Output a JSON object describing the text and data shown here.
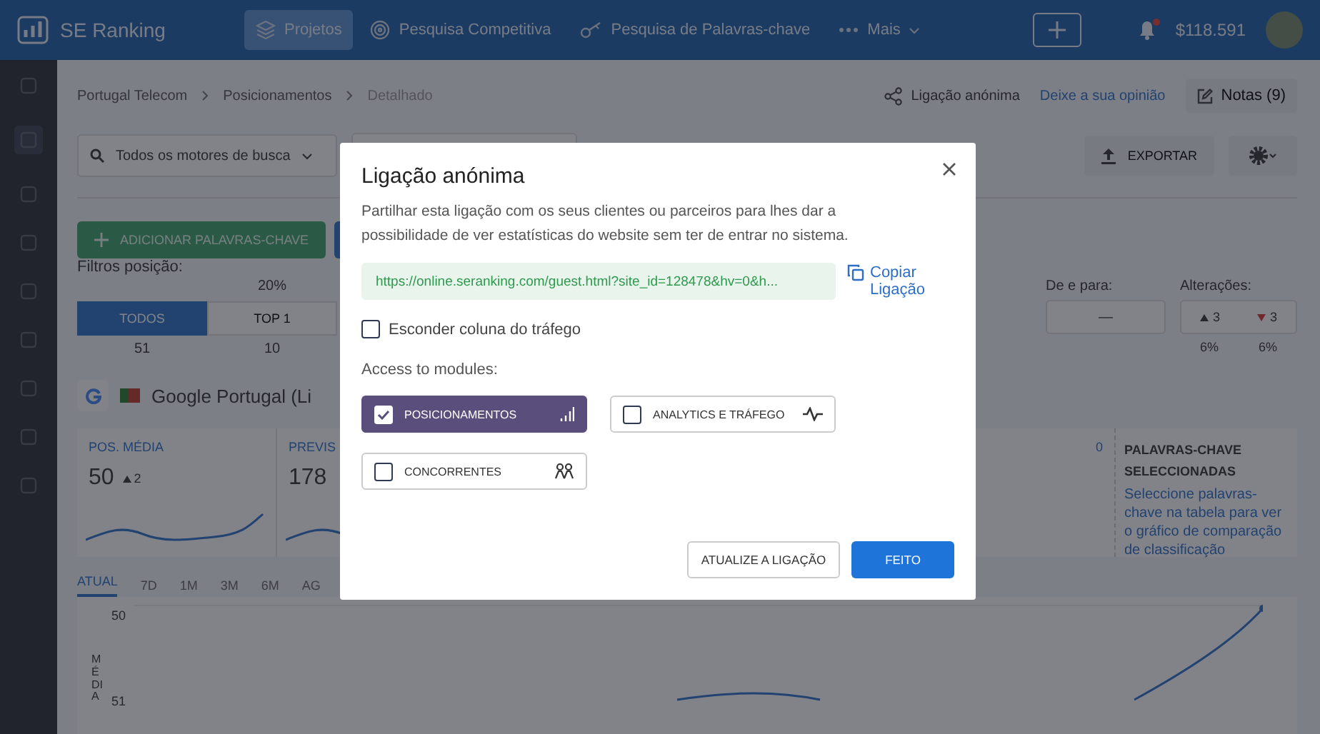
{
  "topbar": {
    "brand": "SE Ranking",
    "nav": [
      {
        "label": "Projetos",
        "selected": true,
        "kind": "layers"
      },
      {
        "label": "Pesquisa Competitiva",
        "selected": false,
        "kind": "target"
      },
      {
        "label": "Pesquisa de Palavras-chave",
        "selected": false,
        "kind": "key"
      },
      {
        "label": "Mais",
        "selected": false,
        "kind": "more"
      }
    ],
    "balance": "$118.591",
    "notification": true
  },
  "breadcrumb": [
    "Portugal Telecom",
    "Posicionamentos",
    "Detalhado"
  ],
  "header_links": {
    "share": "Ligação anónima",
    "feedback": "Deixe a sua opinião",
    "notes": "Notas (9)"
  },
  "toolbar": {
    "search_engine": "Todos os motores de busca",
    "export": "EXPORTAR",
    "add_keywords": "ADICIONAR PALAVRAS-CHAVE"
  },
  "filters": {
    "label": "Filtros posição:",
    "segments": [
      {
        "label": "TODOS",
        "count": "51",
        "selected": true
      },
      {
        "label": "TOP 1",
        "share": "20%",
        "count": "10",
        "selected": false
      }
    ],
    "range_label": "De e para:",
    "range_value": "—",
    "changes_label": "Alterações:",
    "changes": [
      {
        "kind": "up",
        "value": "3",
        "percent": "6%"
      },
      {
        "kind": "down",
        "value": "3",
        "percent": "6%"
      }
    ]
  },
  "engine": {
    "title": "Google Portugal (Li"
  },
  "cards": [
    {
      "label": "POS. MÉDIA",
      "value": "50",
      "change": "2"
    },
    {
      "label": "PREVIS",
      "value": "178"
    },
    {
      "label": "0"
    }
  ],
  "selected_keywords": {
    "title": "PALAVRAS-CHAVE SELECCIONADAS",
    "text": "Seleccione palavras-chave na tabela para ver o gráfico de comparação de classificação"
  },
  "periods": [
    {
      "label": "ATUAL",
      "selected": true
    },
    {
      "label": "7D",
      "selected": false
    },
    {
      "label": "1M",
      "selected": false
    },
    {
      "label": "3M",
      "selected": false
    },
    {
      "label": "6M",
      "selected": false
    },
    {
      "label": "AG",
      "selected": false
    }
  ],
  "chart": {
    "axis_label": "MÉDIA",
    "ticks": [
      "50",
      "51"
    ]
  },
  "modal": {
    "title": "Ligação anónima",
    "description": "Partilhar esta ligação com os seus clientes ou parceiros para lhes dar a possibilidade de ver estatísticas do website sem ter de entrar no sistema.",
    "url": "https://online.seranking.com/guest.html?site_id=128478&hv=0&h...",
    "copy_link": "Copiar Ligação",
    "hide_traffic": {
      "label": "Esconder coluna do tráfego",
      "checked": false
    },
    "modules_label": "Access to modules:",
    "modules": [
      {
        "label": "POSICIONAMENTOS",
        "kind": "rankings",
        "checked": true
      },
      {
        "label": "ANALYTICS E TRÁFEGO",
        "kind": "analytics",
        "checked": false
      },
      {
        "label": "CONCORRENTES",
        "kind": "competitors",
        "checked": false
      }
    ],
    "buttons": {
      "update": "ATUALIZE A LIGAÇÃO",
      "done": "FEITO"
    }
  }
}
